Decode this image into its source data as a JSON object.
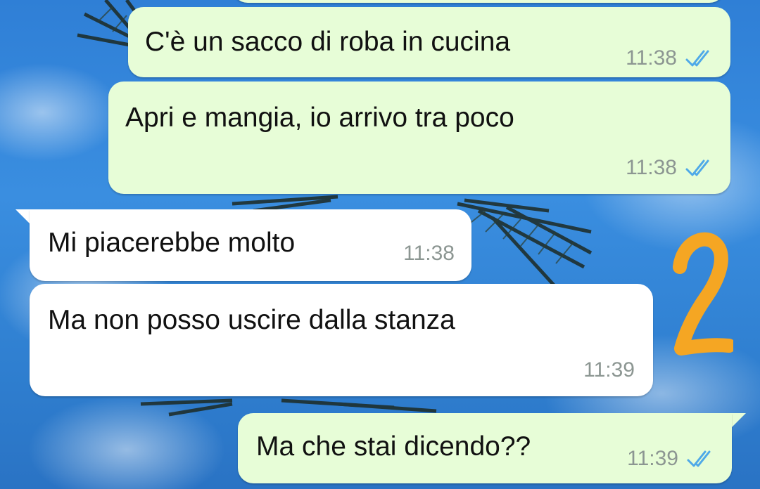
{
  "chat": {
    "messages": [
      {
        "direction": "outgoing",
        "text": "C'è un sacco di roba in cucina",
        "time": "11:38",
        "status": "read-double-check-icon"
      },
      {
        "direction": "outgoing",
        "text": "Apri e mangia, io arrivo tra poco",
        "time": "11:38",
        "status": "read-double-check-icon"
      },
      {
        "direction": "incoming",
        "text": "Mi piacerebbe molto",
        "time": "11:38"
      },
      {
        "direction": "incoming",
        "text": "Ma non posso uscire dalla stanza",
        "time": "11:39"
      },
      {
        "direction": "outgoing",
        "text": "Ma che stai dicendo??",
        "time": "11:39",
        "status": "read-double-check-icon"
      }
    ]
  },
  "annotation": {
    "number_icon": "number-two-overlay",
    "color": "#f5a623"
  },
  "colors": {
    "outgoing_bubble": "#e7fdd7",
    "incoming_bubble": "#ffffff",
    "read_check": "#4fa9e8",
    "timestamp": "#8c9692"
  }
}
